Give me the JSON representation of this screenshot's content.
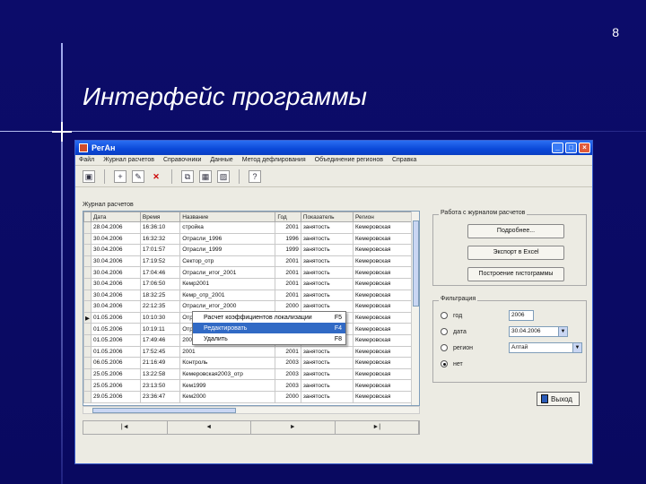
{
  "slide": {
    "number": "8",
    "title": "Интерфейс программы"
  },
  "window": {
    "title": "РегАн",
    "menu": [
      "Файл",
      "Журнал расчетов",
      "Справочники",
      "Данные",
      "Метод дефлирования",
      "Объединение регионов",
      "Справка"
    ]
  },
  "journal": {
    "label": "Журнал расчетов",
    "columns": [
      "Дата",
      "Время",
      "Название",
      "Год",
      "Показатель",
      "Регион"
    ],
    "rows": [
      [
        "28.04.2006",
        "16:36:10",
        "стройка",
        "2001",
        "занятость",
        "Кемеровская"
      ],
      [
        "30.04.2006",
        "16:32:32",
        "Отрасли_1996",
        "1996",
        "занятость",
        "Кемеровская"
      ],
      [
        "30.04.2006",
        "17:01:57",
        "Отрасли_1999",
        "1999",
        "занятость",
        "Кемеровская"
      ],
      [
        "30.04.2006",
        "17:19:52",
        "Сектор_отр",
        "2001",
        "занятость",
        "Кемеровская"
      ],
      [
        "30.04.2006",
        "17:04:46",
        "Отрасли_итог_2001",
        "2001",
        "занятость",
        "Кемеровская"
      ],
      [
        "30.04.2006",
        "17:06:50",
        "Кемр2001",
        "2001",
        "занятость",
        "Кемеровская"
      ],
      [
        "30.04.2006",
        "18:32:25",
        "Кемр_отр_2001",
        "2001",
        "занятость",
        "Кемеровская"
      ],
      [
        "30.04.2006",
        "22:12:35",
        "Отрасли_итог_2000",
        "2000",
        "занятость",
        "Кемеровская"
      ],
      [
        "01.05.2006",
        "10:10:30",
        "Отрасли",
        "2001",
        "занятость",
        "Кемеровская"
      ],
      [
        "01.05.2006",
        "10:19:11",
        "Отрасли",
        "2001",
        "занятость",
        "Кемеровская"
      ],
      [
        "01.05.2006",
        "17:49:46",
        "2001",
        "2001",
        "занятость",
        "Кемеровская"
      ],
      [
        "01.05.2006",
        "17:52:45",
        "2001",
        "2001",
        "занятость",
        "Кемеровская"
      ],
      [
        "06.05.2006",
        "21:16:49",
        "Контроль",
        "2003",
        "занятость",
        "Кемеровская"
      ],
      [
        "25.05.2006",
        "13:22:58",
        "Кемеровская2003_отр",
        "2003",
        "занятость",
        "Кемеровская"
      ],
      [
        "25.05.2006",
        "23:13:50",
        "Кем1999",
        "2003",
        "занятость",
        "Кемеровская"
      ],
      [
        "29.05.2006",
        "23:36:47",
        "Кем2000",
        "2000",
        "занятость",
        "Кемеровская"
      ]
    ]
  },
  "context_menu": {
    "items": [
      {
        "label": "Расчет коэффициентов локализации",
        "key": "F5"
      },
      {
        "label": "Редактировать",
        "key": "F4"
      },
      {
        "label": "Удалить",
        "key": "F8"
      }
    ]
  },
  "results_group": {
    "title": "Работа с журналом расчетов",
    "buttons": [
      "Подробнее...",
      "Экспорт в Excel",
      "Построение гистограммы"
    ]
  },
  "filter_group": {
    "title": "Фильтрация",
    "options": [
      "год",
      "дата",
      "регион",
      "нет"
    ],
    "year_value": "2006",
    "date_value": "30.04.2006",
    "region_value": "Алтай"
  },
  "exit_label": "Выход",
  "nav_buttons": [
    "|◄",
    "◄",
    "►",
    "►|"
  ]
}
